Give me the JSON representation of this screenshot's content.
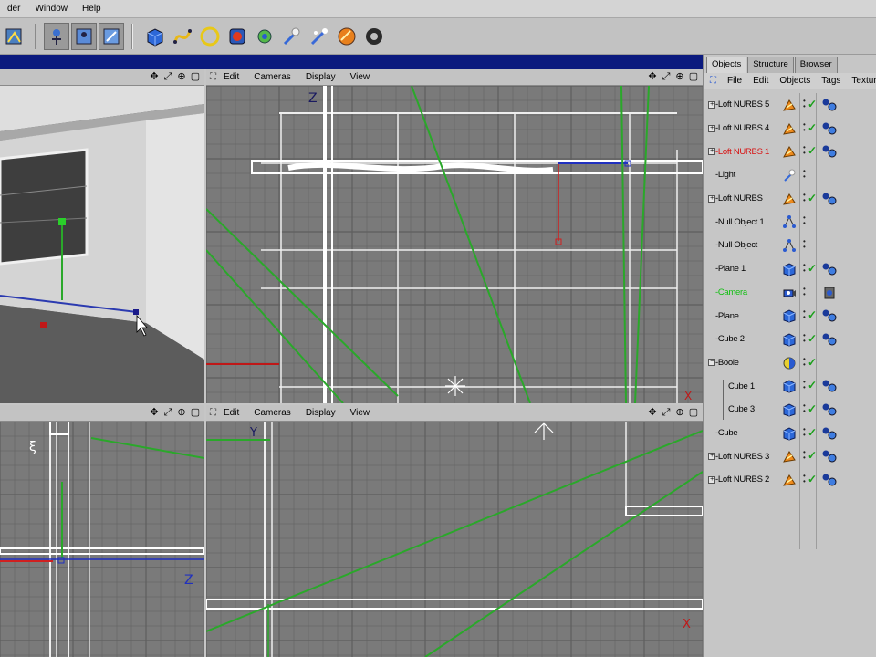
{
  "menubar": {
    "items": [
      "der",
      "Window",
      "Help"
    ]
  },
  "toolbar": {
    "buttons": [
      "move-tool-icon",
      "scale-tool-icon",
      "rotate-tool-icon",
      "cube-primitive-icon",
      "spline-icon",
      "circle-icon",
      "nurbs-icon",
      "deformer-icon",
      "light-icon",
      "scene-icon",
      "material-icon",
      "camera-icon"
    ]
  },
  "viewports": {
    "perspective": {
      "ctrls": [
        "✥",
        "⤢",
        "🔍",
        "▢"
      ]
    },
    "top": {
      "menu": [
        "Edit",
        "Cameras",
        "Display",
        "View"
      ],
      "axis_v": "Z",
      "axis_h": "X"
    },
    "side": {
      "axis_h": "Z"
    },
    "front": {
      "menu": [
        "Edit",
        "Cameras",
        "Display",
        "View"
      ],
      "axis_v": "Y",
      "axis_h": "X"
    }
  },
  "panel": {
    "tabs": [
      "Objects",
      "Structure",
      "Browser"
    ],
    "menu": [
      "File",
      "Edit",
      "Objects",
      "Tags",
      "Texture"
    ],
    "objects": [
      {
        "name": "Loft NURBS 5",
        "expand": "+",
        "color": "normal",
        "icon": "nurbs",
        "check": true,
        "tag": "material"
      },
      {
        "name": "Loft NURBS 4",
        "expand": "+",
        "color": "normal",
        "icon": "nurbs",
        "check": true,
        "tag": "material"
      },
      {
        "name": "Loft NURBS 1",
        "expand": "+",
        "color": "red",
        "icon": "nurbs",
        "check": true,
        "tag": "material"
      },
      {
        "name": "Light",
        "expand": "",
        "color": "normal",
        "icon": "light",
        "check": false,
        "tag": ""
      },
      {
        "name": "Loft NURBS",
        "expand": "+",
        "color": "normal",
        "icon": "nurbs",
        "check": true,
        "tag": "material"
      },
      {
        "name": "Null Object 1",
        "expand": "",
        "color": "normal",
        "icon": "null",
        "check": false,
        "tag": ""
      },
      {
        "name": "Null Object",
        "expand": "",
        "color": "normal",
        "icon": "null",
        "check": false,
        "tag": ""
      },
      {
        "name": "Plane 1",
        "expand": "",
        "color": "normal",
        "icon": "cube",
        "check": true,
        "tag": "material"
      },
      {
        "name": "Camera",
        "expand": "",
        "color": "green",
        "icon": "camera",
        "check": false,
        "tag": "target"
      },
      {
        "name": "Plane",
        "expand": "",
        "color": "normal",
        "icon": "cube",
        "check": true,
        "tag": "material"
      },
      {
        "name": "Cube 2",
        "expand": "",
        "color": "normal",
        "icon": "cube",
        "check": true,
        "tag": "material"
      },
      {
        "name": "Boole",
        "expand": "−",
        "color": "normal",
        "icon": "boole",
        "check": true,
        "tag": ""
      },
      {
        "name": "Cube 1",
        "expand": "",
        "color": "normal",
        "icon": "cube",
        "check": true,
        "tag": "material",
        "child": true
      },
      {
        "name": "Cube 3",
        "expand": "",
        "color": "normal",
        "icon": "cube",
        "check": true,
        "tag": "material",
        "child": true
      },
      {
        "name": "Cube",
        "expand": "",
        "color": "normal",
        "icon": "cube",
        "check": true,
        "tag": "material"
      },
      {
        "name": "Loft NURBS 3",
        "expand": "+",
        "color": "normal",
        "icon": "nurbs",
        "check": true,
        "tag": "material"
      },
      {
        "name": "Loft NURBS 2",
        "expand": "+",
        "color": "normal",
        "icon": "nurbs",
        "check": true,
        "tag": "material"
      }
    ]
  },
  "colors": {
    "accent_bar": "#0b1a7e",
    "grid_bg": "#7a7a7a",
    "spline_green": "#2aa82a",
    "selected_red": "#d81010"
  }
}
